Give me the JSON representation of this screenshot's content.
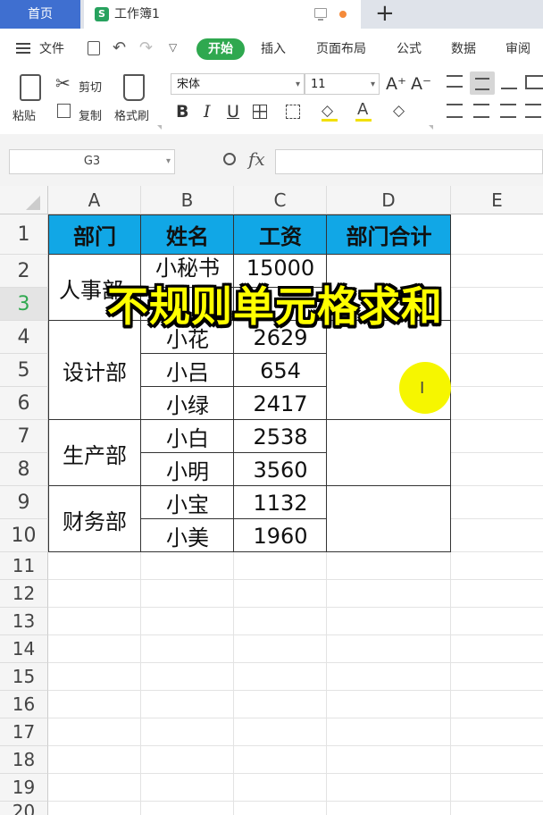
{
  "titlebar": {
    "home_tab": "首页",
    "doc_tab": "工作簿1",
    "doc_icon": "S",
    "new_tab_icon": "+"
  },
  "menubar": {
    "file": "文件",
    "start": "开始",
    "insert": "插入",
    "layout": "页面布局",
    "formula": "公式",
    "data": "数据",
    "review": "审阅"
  },
  "ribbon": {
    "paste": "粘贴",
    "cut": "剪切",
    "copy": "复制",
    "format_painter": "格式刷",
    "font_name": "宋体",
    "font_size": "11",
    "font_grow": "A⁺",
    "font_shrink": "A⁻",
    "bold": "B",
    "italic": "I",
    "underline": "U"
  },
  "formula_bar": {
    "cell_ref": "G3",
    "fx": "fx",
    "value": ""
  },
  "columns": [
    "A",
    "B",
    "C",
    "D",
    "E"
  ],
  "rows": [
    "1",
    "2",
    "3",
    "4",
    "5",
    "6",
    "7",
    "8",
    "9",
    "10",
    "11",
    "12",
    "13",
    "14",
    "15",
    "16",
    "17",
    "18",
    "19",
    "20"
  ],
  "table": {
    "headers": [
      "部门",
      "姓名",
      "工资",
      "部门合计"
    ],
    "departments": [
      "人事部",
      "设计部",
      "生产部",
      "财务部"
    ],
    "names": [
      "小秘书",
      "小花",
      "小吕",
      "小绿",
      "小白",
      "小明",
      "小宝",
      "小美"
    ],
    "salaries": [
      "15000",
      "2629",
      "654",
      "2417",
      "2538",
      "3560",
      "1132",
      "1960"
    ]
  },
  "overlay_caption": "不规则单元格求和",
  "colors": {
    "header_fill": "#11a7e6",
    "accent": "#2fa84f",
    "caption": "#ffff00",
    "home_tab": "#3f6fd0"
  }
}
